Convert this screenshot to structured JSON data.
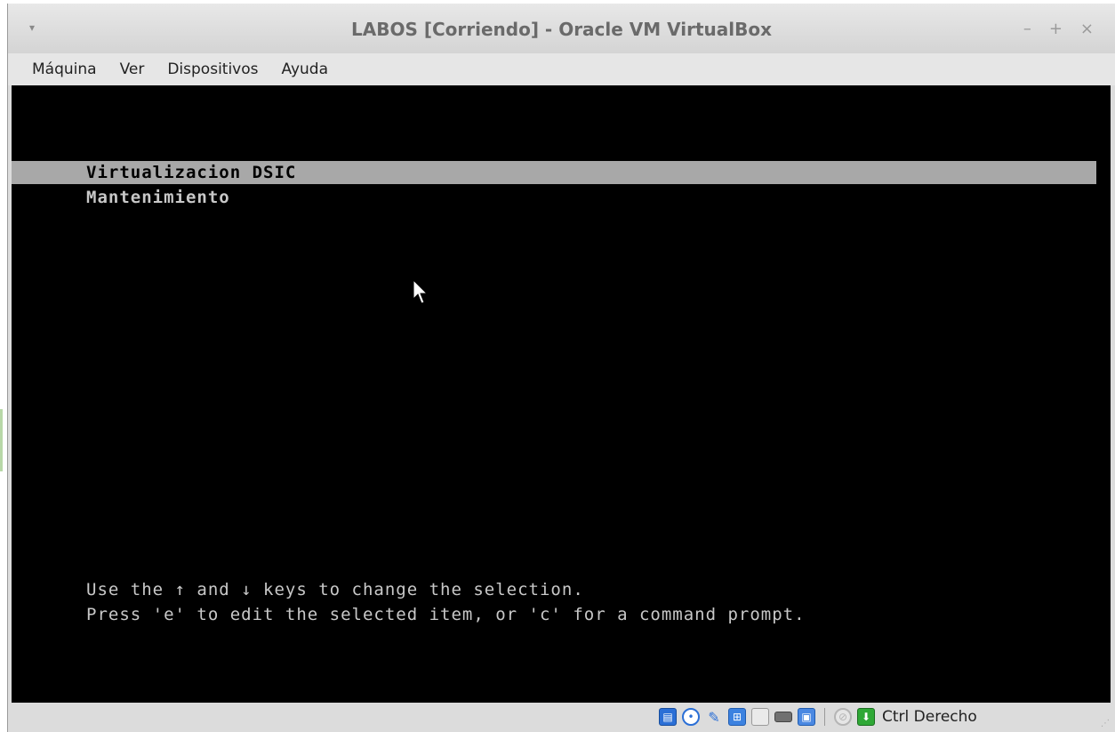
{
  "window": {
    "title": "LABOS [Corriendo] - Oracle VM VirtualBox",
    "controls": {
      "minimize": "–",
      "maximize": "+",
      "close": "×"
    },
    "menu_arrow": "▾"
  },
  "menubar": {
    "items": [
      {
        "label": "Máquina"
      },
      {
        "label": "Ver"
      },
      {
        "label": "Dispositivos"
      },
      {
        "label": "Ayuda"
      }
    ]
  },
  "vm_screen": {
    "boot_menu": {
      "entries": [
        {
          "label": "Virtualizacion DSIC",
          "selected": true
        },
        {
          "label": "Mantenimiento",
          "selected": false
        }
      ],
      "help_lines": [
        "Use the ↑ and ↓ keys to change the selection.",
        "Press 'e' to edit the selected item, or 'c' for a command prompt."
      ]
    }
  },
  "statusbar": {
    "icons": [
      "hard-disk-icon",
      "optical-drive-icon",
      "usb-icon",
      "network-icon",
      "shared-folders-icon",
      "video-capture-icon",
      "cpu-virtualization-icon",
      "mouse-integration-icon",
      "keyboard-capture-icon"
    ],
    "host_key": "Ctrl Derecho"
  },
  "colors": {
    "screen_bg": "#000000",
    "selection_bg": "#a8a8a8",
    "text_normal": "#c8c8c8"
  }
}
